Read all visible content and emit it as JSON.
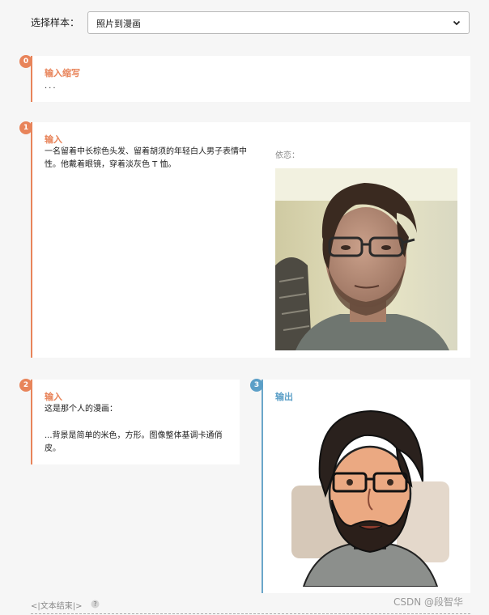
{
  "selector": {
    "label": "选择样本：",
    "value": "照片到漫画"
  },
  "sections": [
    {
      "badge": "0",
      "title": "输入缩写",
      "text": "..."
    },
    {
      "badge": "1",
      "title": "输入",
      "text": "一名留着中长棕色头发、留着胡须的年轻白人男子表情中性。他戴着眼镜，穿着淡灰色 T 恤。",
      "image_label": "依恋："
    },
    {
      "badge": "2",
      "title": "输入",
      "text_line1": "这是那个人的漫画：",
      "text_line2": "...背景是简单的米色，方形。图像整体基调卡通俏皮。"
    },
    {
      "badge": "3",
      "title": "输出"
    }
  ],
  "footer": {
    "end_text": "<|文本结束|>",
    "watermark": "CSDN @段智华"
  },
  "colors": {
    "accent_orange": "#e8845a",
    "accent_blue": "#5b9fc7"
  }
}
